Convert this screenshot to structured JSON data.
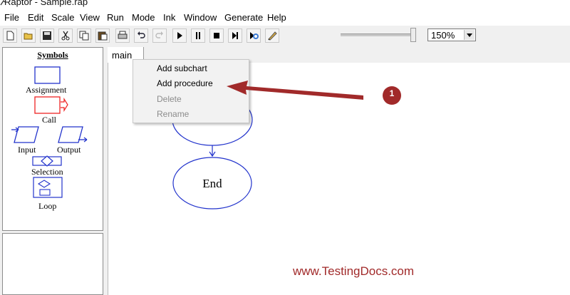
{
  "window": {
    "title": "Raptor - Sample.rap"
  },
  "menubar": [
    "File",
    "Edit",
    "Scale",
    "View",
    "Run",
    "Mode",
    "Ink",
    "Window",
    "Generate",
    "Help"
  ],
  "toolbar": {
    "buttons": [
      "new-icon",
      "open-icon",
      "save-icon",
      "cut-icon",
      "copy-icon",
      "paste-icon",
      "print-icon",
      "undo-icon",
      "redo-icon",
      "run-icon",
      "pause-icon",
      "stop-icon",
      "step-icon",
      "debug-icon",
      "ink-pen-icon"
    ],
    "zoom": {
      "value": "150%"
    },
    "speed_slider": {
      "level": 1.0
    }
  },
  "symbols_panel": {
    "title": "Symbols",
    "items": [
      "Assignment",
      "Call",
      "Input",
      "Output",
      "Selection",
      "Loop"
    ]
  },
  "tabs": [
    {
      "label": "main"
    }
  ],
  "context_menu": {
    "items": [
      {
        "label": "Add subchart",
        "enabled": true
      },
      {
        "label": "Add procedure",
        "enabled": true
      },
      {
        "label": "Delete",
        "enabled": false
      },
      {
        "label": "Rename",
        "enabled": false
      }
    ]
  },
  "canvas": {
    "end_label": "End"
  },
  "annotation": {
    "badge": "1",
    "color": "#a12a2a"
  },
  "watermark": "www.TestingDocs.com"
}
